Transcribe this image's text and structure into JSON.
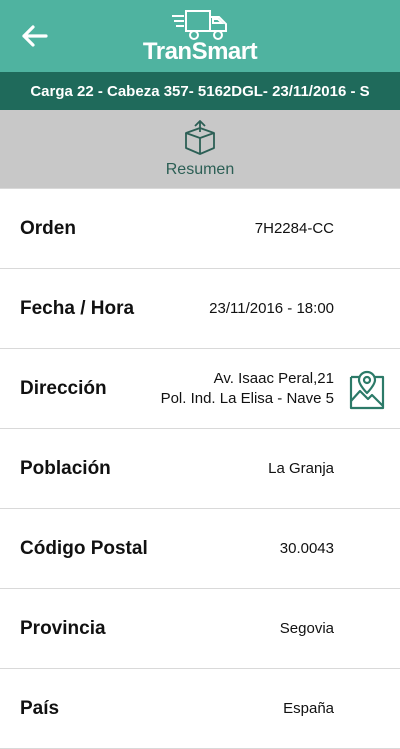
{
  "header": {
    "logo_text": "TranSmart",
    "back_icon": "arrow-left-icon",
    "accent_color": "#4fb3a0"
  },
  "subheader": {
    "text": "Carga 22 - Cabeza 357- 5162DGL- 23/11/2016 - S",
    "color": "#1f6a5b"
  },
  "summary": {
    "label": "Resumen",
    "icon": "box-upload-icon"
  },
  "details": [
    {
      "label": "Orden",
      "value": "7H2284-CC"
    },
    {
      "label": "Fecha / Hora",
      "value": "23/11/2016 - 18:00"
    },
    {
      "label": "Dirección",
      "value_line1": "Av. Isaac Peral,21",
      "value_line2": "Pol. Ind. La Elisa - Nave 5",
      "action_icon": "map-pin-icon"
    },
    {
      "label": "Población",
      "value": "La Granja"
    },
    {
      "label": "Código Postal",
      "value": "30.0043"
    },
    {
      "label": "Provincia",
      "value": "Segovia"
    },
    {
      "label": "País",
      "value": "España"
    }
  ]
}
